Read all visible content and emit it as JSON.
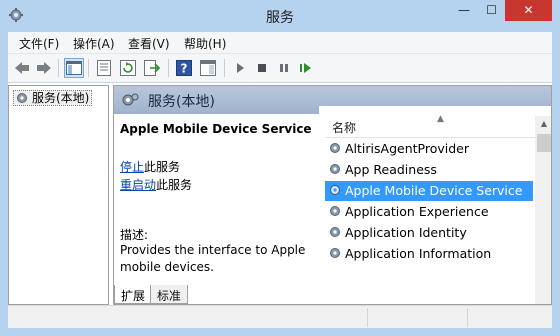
{
  "window": {
    "title": "服务",
    "min_symbol": "—",
    "max_symbol": "☐",
    "close_symbol": "✕",
    "icon": "gear-icon"
  },
  "menu": {
    "items": [
      "文件(F)",
      "操作(A)",
      "查看(V)",
      "帮助(H)"
    ]
  },
  "toolbar": {
    "buttons": [
      "back-icon",
      "forward-icon",
      "show-hide-console-tree-icon",
      "properties-icon",
      "refresh-icon",
      "export-list-icon",
      "help-icon",
      "action-pane-icon",
      "start-service-icon",
      "stop-service-icon",
      "pause-service-icon",
      "resume-service-icon"
    ]
  },
  "tree": {
    "root_label": "服务(本地)"
  },
  "panel": {
    "title": "服务(本地)",
    "selected_service": "Apple Mobile Device Service",
    "stop_link": "停止",
    "stop_suffix": "此服务",
    "restart_link": "重启动",
    "restart_suffix": "此服务",
    "description_label": "描述:",
    "description_text": "Provides the interface to Apple mobile devices."
  },
  "list": {
    "column_header": "名称",
    "rows": [
      {
        "name": "AltirisAgentProvider",
        "selected": false
      },
      {
        "name": "App Readiness",
        "selected": false
      },
      {
        "name": "Apple Mobile Device Service",
        "selected": true
      },
      {
        "name": "Application Experience",
        "selected": false
      },
      {
        "name": "Application Identity",
        "selected": false
      },
      {
        "name": "Application Information",
        "selected": false
      }
    ]
  },
  "tabs": {
    "extended": "扩展",
    "standard": "标准",
    "active": "扩展"
  },
  "colors": {
    "titlebar": "#b5d2ee",
    "selection": "#3399ff",
    "close_button": "#c7372f",
    "link": "#0645ad"
  }
}
